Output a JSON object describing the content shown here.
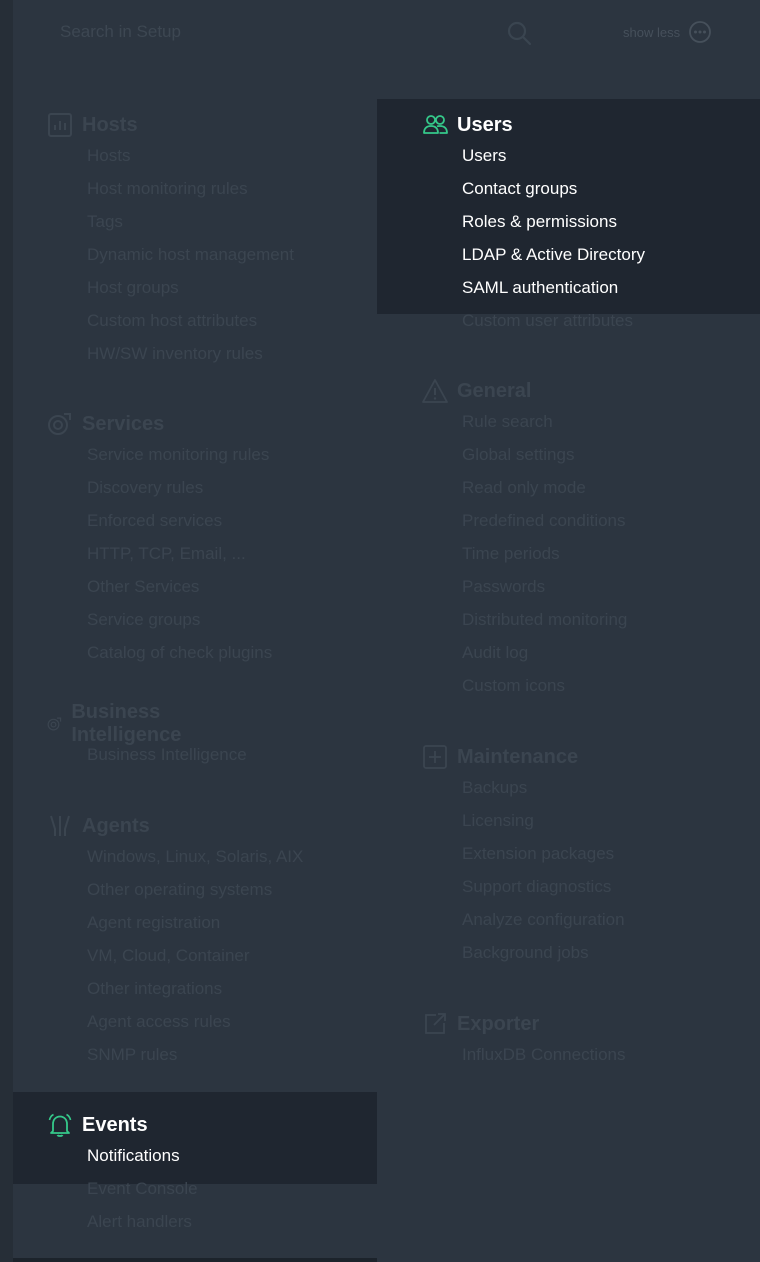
{
  "search": {
    "placeholder": "Search in Setup"
  },
  "toggle": {
    "label": "show less"
  },
  "colors": {
    "background": "#2c3540",
    "highlight": "#1f2630",
    "accent": "#35c98a",
    "dim_text": "#3b4550"
  },
  "groups": {
    "hosts": {
      "title": "Hosts",
      "icon": "hosts-icon",
      "items": [
        "Hosts",
        "Host monitoring rules",
        "Tags",
        "Dynamic host management",
        "Host groups",
        "Custom host attributes",
        "HW/SW inventory rules"
      ]
    },
    "services": {
      "title": "Services",
      "icon": "services-icon",
      "items": [
        "Service monitoring rules",
        "Discovery rules",
        "Enforced services",
        "HTTP, TCP, Email, ...",
        "Other Services",
        "Service groups",
        "Catalog of check plugins"
      ]
    },
    "bi": {
      "title": "Business Intelligence",
      "icon": "business-intelligence-icon",
      "items": [
        "Business Intelligence"
      ]
    },
    "agents": {
      "title": "Agents",
      "icon": "agents-icon",
      "items": [
        "Windows, Linux, Solaris, AIX",
        "Other operating systems",
        "Agent registration",
        "VM, Cloud, Container",
        "Other integrations",
        "Agent access rules",
        "SNMP rules"
      ]
    },
    "events": {
      "title": "Events",
      "icon": "bell-icon",
      "items": [
        "Notifications",
        "Event Console",
        "Alert handlers"
      ]
    },
    "users": {
      "title": "Users",
      "icon": "users-icon",
      "items": [
        "Users",
        "Contact groups",
        "Roles & permissions",
        "LDAP & Active Directory",
        "SAML authentication",
        "Custom user attributes"
      ]
    },
    "general": {
      "title": "General",
      "icon": "warning-icon",
      "items": [
        "Rule search",
        "Global settings",
        "Read only mode",
        "Predefined conditions",
        "Time periods",
        "Passwords",
        "Distributed monitoring",
        "Audit log",
        "Custom icons"
      ]
    },
    "maintenance": {
      "title": "Maintenance",
      "icon": "maintenance-icon",
      "items": [
        "Backups",
        "Licensing",
        "Extension packages",
        "Support diagnostics",
        "Analyze configuration",
        "Background jobs"
      ]
    },
    "exporter": {
      "title": "Exporter",
      "icon": "export-icon",
      "items": [
        "InfluxDB Connections"
      ]
    }
  }
}
